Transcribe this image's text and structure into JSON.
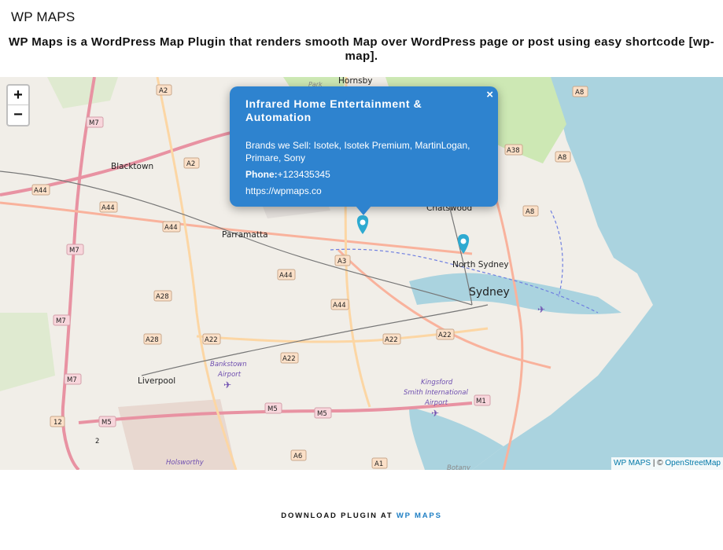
{
  "site_title": "WP MAPS",
  "intro_text": "WP Maps is a WordPress Map Plugin that renders smooth Map over WordPress page or post using easy shortcode [wp-map].",
  "map": {
    "zoom_in_label": "+",
    "zoom_out_label": "−",
    "popup": {
      "title": "Infrared Home Entertainment & Automation",
      "brands": "Brands we Sell: Isotek, Isotek Premium, MartinLogan, Primare, Sony",
      "phone_label": "Phone:",
      "phone": "+123435345",
      "url": "https://wpmaps.co",
      "close_label": "×"
    },
    "markers": [
      "Infrared Home Entertainment & Automation",
      "North Sydney"
    ],
    "marker_color": "#2eaad1",
    "popup_color": "#2e83cf",
    "place_labels": [
      "Hornsby",
      "Blacktown",
      "Parramatta",
      "Chatswood",
      "North Sydney",
      "Sydney",
      "Liverpool",
      "Bankstown Airport",
      "Kingsford Smith International Airport",
      "Holsworthy",
      "Park",
      "Botany"
    ],
    "road_shields": [
      "A2",
      "M7",
      "A2",
      "A44",
      "A44",
      "A44",
      "M7",
      "A28",
      "M7",
      "A28",
      "A22",
      "A22",
      "M7",
      "12",
      "M5",
      "M5",
      "M5",
      "A3",
      "A44",
      "A44",
      "A22",
      "A22",
      "M1",
      "A38",
      "A8",
      "A8",
      "A8",
      "A6",
      "A1",
      "2"
    ],
    "attribution_link": "WP MAPS",
    "attribution_sep": " | © ",
    "attribution_osm": "OpenStreetMap"
  },
  "footer": {
    "text": "DOWNLOAD PLUGIN AT ",
    "link": "WP MAPS"
  }
}
